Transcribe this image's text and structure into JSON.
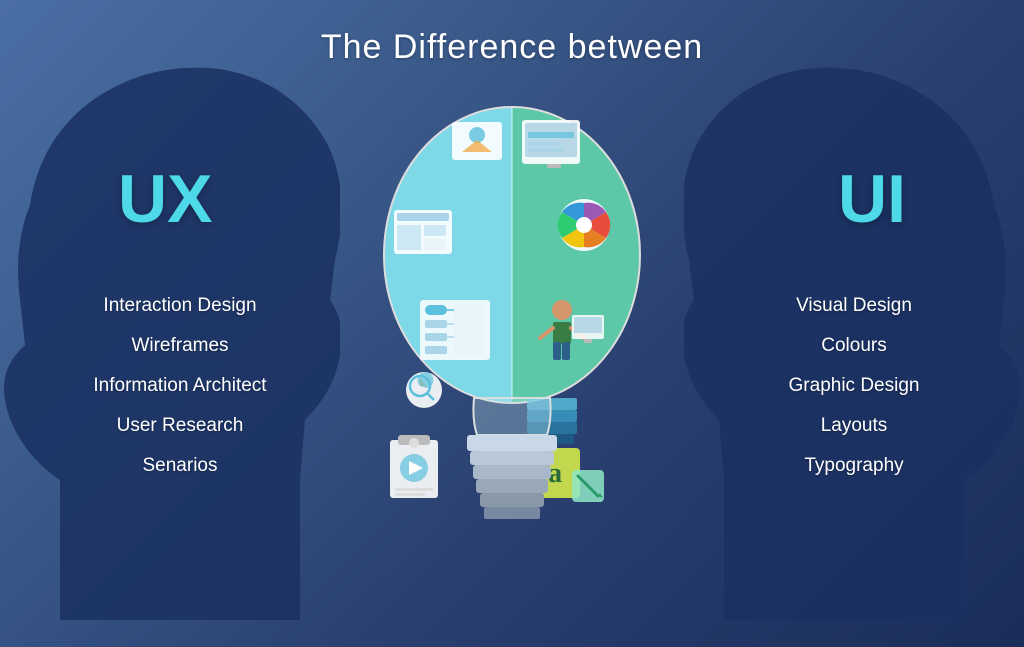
{
  "page": {
    "title": "The Difference between",
    "background_gradient": "blue-purple"
  },
  "ux": {
    "label": "UX",
    "color": "#4dd9e8",
    "items": [
      "Interaction Design",
      "Wireframes",
      "Information Architect",
      "User Research",
      "Senarios"
    ]
  },
  "ui": {
    "label": "UI",
    "color": "#4dd9e8",
    "items": [
      "Visual Design",
      "Colours",
      "Graphic Design",
      "Layouts",
      "Typography"
    ]
  },
  "bulb": {
    "left_color": "#7dd8e8",
    "right_color": "#5cc8a8"
  }
}
